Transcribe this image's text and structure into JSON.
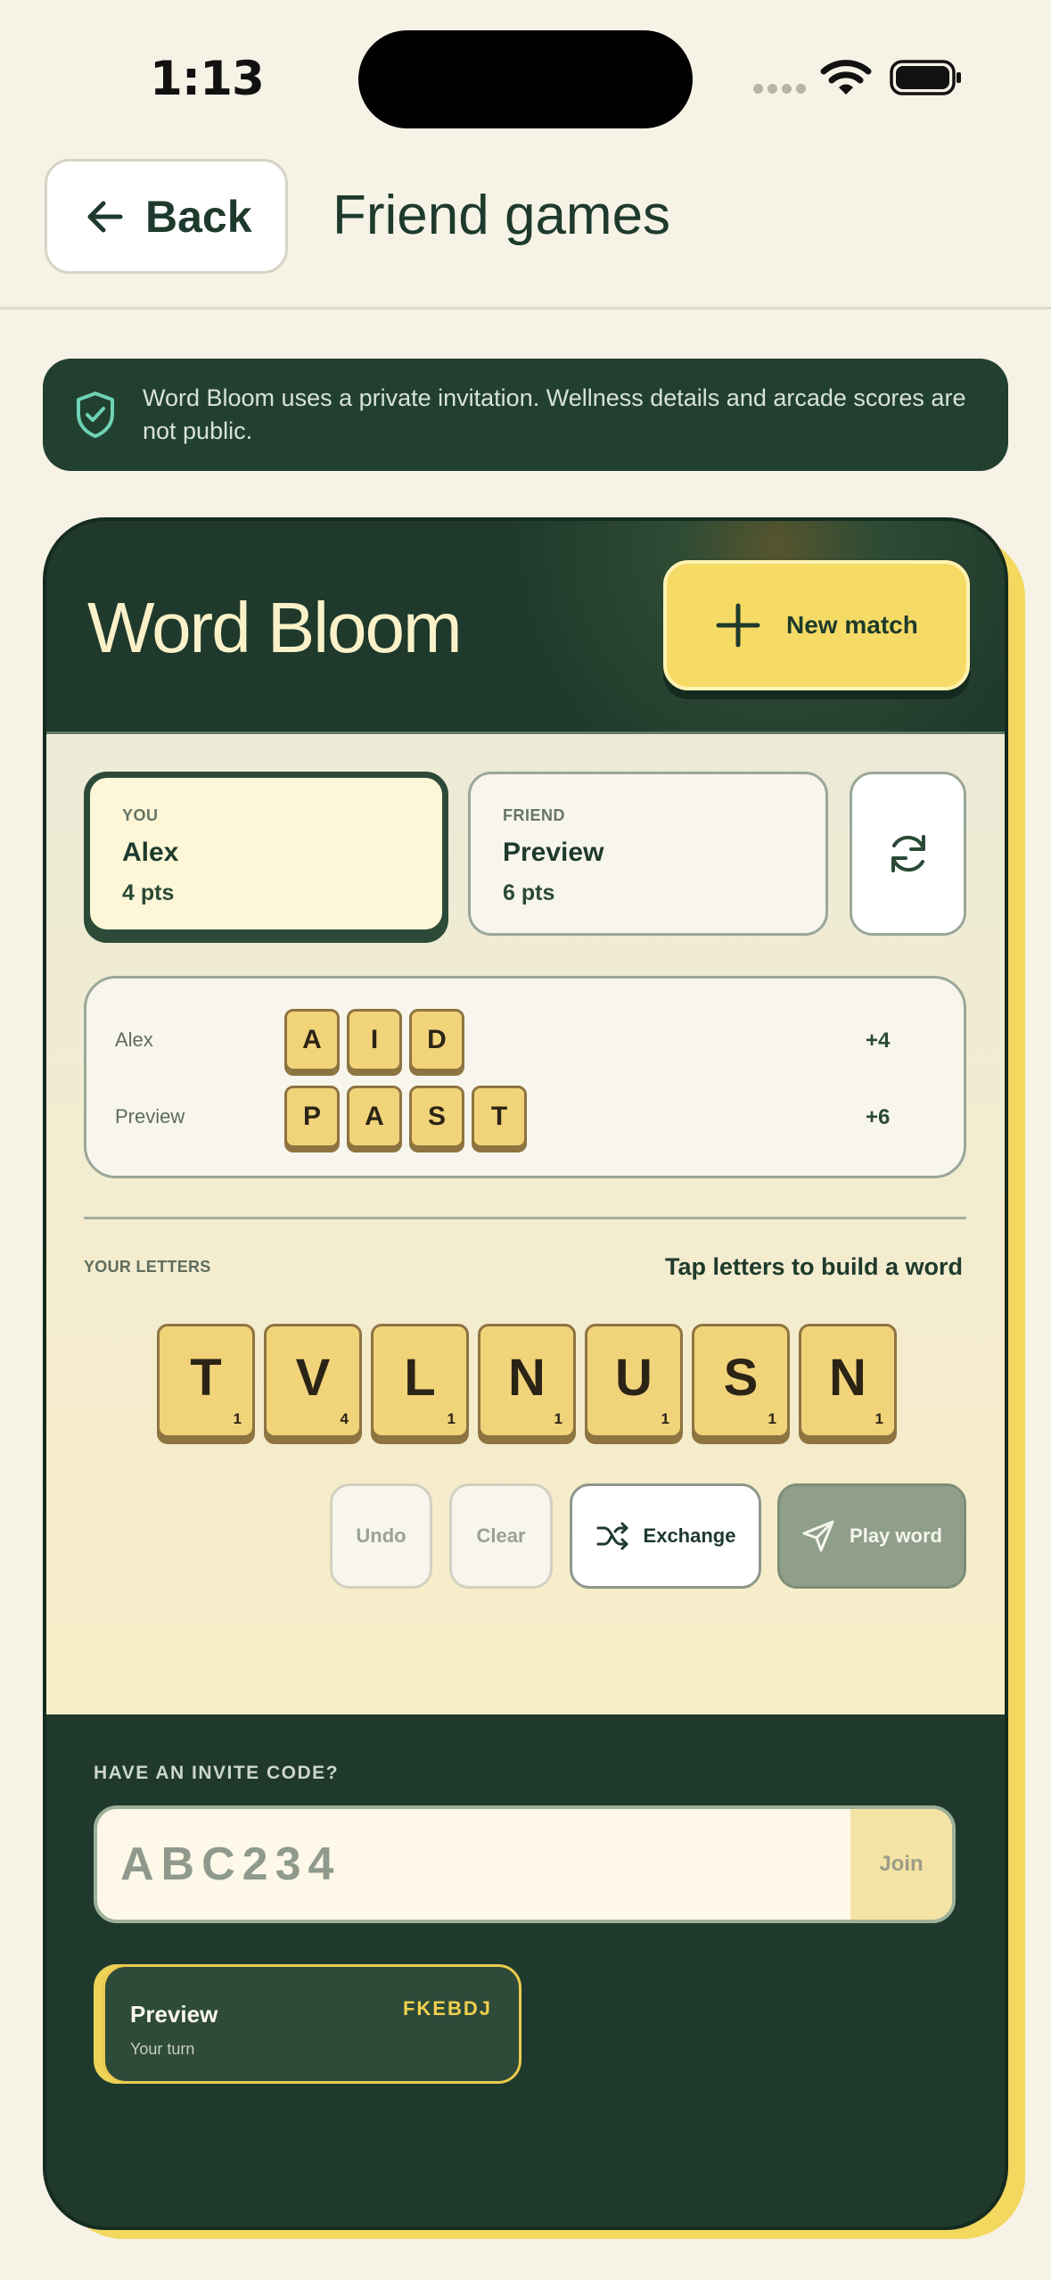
{
  "status_bar": {
    "time": "1:13"
  },
  "header": {
    "back_label": "Back",
    "title": "Friend games"
  },
  "privacy_notice": "Word Bloom uses a private invitation. Wellness details and arcade scores are not public.",
  "game": {
    "title": "Word Bloom",
    "new_match_label": "New match",
    "players": [
      {
        "role": "YOU",
        "name": "Alex",
        "points": "4 pts"
      },
      {
        "role": "FRIEND",
        "name": "Preview",
        "points": "6 pts"
      }
    ],
    "history": [
      {
        "player": "Alex",
        "letters": [
          "A",
          "I",
          "D"
        ],
        "score": "+4"
      },
      {
        "player": "Preview",
        "letters": [
          "P",
          "A",
          "S",
          "T"
        ],
        "score": "+6"
      }
    ],
    "rack_label": "YOUR LETTERS",
    "rack_hint": "Tap letters to build a word",
    "rack": [
      {
        "letter": "T",
        "points": "1"
      },
      {
        "letter": "V",
        "points": "4"
      },
      {
        "letter": "L",
        "points": "1"
      },
      {
        "letter": "N",
        "points": "1"
      },
      {
        "letter": "U",
        "points": "1"
      },
      {
        "letter": "S",
        "points": "1"
      },
      {
        "letter": "N",
        "points": "1"
      }
    ],
    "actions": {
      "undo": "Undo",
      "clear": "Clear",
      "exchange": "Exchange",
      "play": "Play word"
    }
  },
  "invite": {
    "label": "HAVE AN INVITE CODE?",
    "placeholder": "ABC234",
    "value": "",
    "join_label": "Join"
  },
  "active_games": [
    {
      "name": "Preview",
      "code": "FKEBDJ",
      "status": "Your turn"
    }
  ],
  "colors": {
    "background": "#f6f2e6",
    "dark_green": "#1f3a2c",
    "accent_yellow": "#f5db66",
    "tile": "#f1d37a"
  }
}
